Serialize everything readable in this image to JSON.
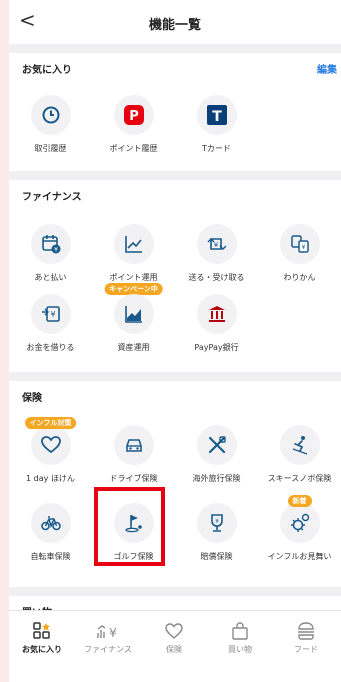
{
  "header": {
    "title": "機能一覧",
    "back": "<"
  },
  "favorites": {
    "title": "お気に入り",
    "edit": "編集",
    "items": [
      {
        "label": "取引履歴",
        "icon": "clock-icon"
      },
      {
        "label": "ポイント履歴",
        "icon": "p-point-icon"
      },
      {
        "label": "Tカード",
        "icon": "t-card-icon"
      }
    ]
  },
  "finance": {
    "title": "ファイナンス",
    "items": [
      {
        "label": "あと払い",
        "icon": "calendar-yen-icon"
      },
      {
        "label": "ポイント運用",
        "icon": "chart-line-icon",
        "badge": "キャンペーン中"
      },
      {
        "label": "送る・受け取る",
        "icon": "send-yen-icon"
      },
      {
        "label": "わりかん",
        "icon": "split-yen-icon"
      },
      {
        "label": "お金を借りる",
        "icon": "borrow-yen-icon"
      },
      {
        "label": "資産運用",
        "icon": "area-chart-icon"
      },
      {
        "label": "PayPay銀行",
        "icon": "bank-icon"
      }
    ]
  },
  "insurance": {
    "title": "保険",
    "items": [
      {
        "label": "1 day ほけん",
        "icon": "heart-icon",
        "badge": "インフル対策"
      },
      {
        "label": "ドライブ保険",
        "icon": "car-icon"
      },
      {
        "label": "海外旅行保険",
        "icon": "airplane-cross-icon"
      },
      {
        "label": "スキースノボ保険",
        "icon": "skier-icon"
      },
      {
        "label": "自転車保険",
        "icon": "bicycle-icon"
      },
      {
        "label": "ゴルフ保険",
        "icon": "golf-flag-icon"
      },
      {
        "label": "賠償保険",
        "icon": "trophy-icon"
      },
      {
        "label": "インフルお見舞い",
        "icon": "virus-icon",
        "badge": "新着"
      }
    ]
  },
  "shopping": {
    "title": "買い物"
  },
  "tabbar": {
    "items": [
      {
        "label": "お気に入り",
        "icon": "favorites-grid-icon",
        "active": true
      },
      {
        "label": "ファイナンス",
        "icon": "finance-icon",
        "active": false
      },
      {
        "label": "保険",
        "icon": "heart-outline-icon",
        "active": false
      },
      {
        "label": "買い物",
        "icon": "shopping-bag-icon",
        "active": false
      },
      {
        "label": "フード",
        "icon": "burger-icon",
        "active": false
      }
    ]
  },
  "colors": {
    "accent": "#e60012",
    "link": "#2a7de1",
    "icon": "#1a5a8a",
    "badge": "#f5a623",
    "background": "#fce9ea"
  }
}
